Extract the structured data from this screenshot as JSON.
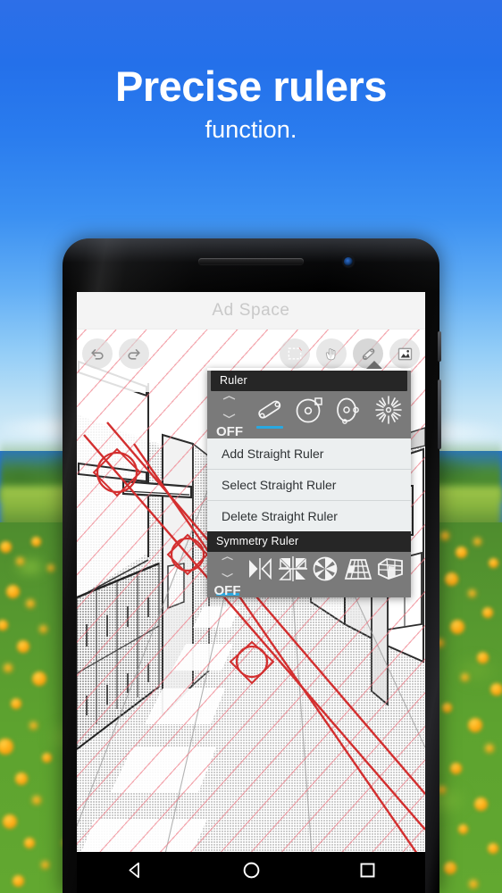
{
  "headline": {
    "line1": "Precise rulers",
    "line2": "function."
  },
  "colors": {
    "sky_top": "#2d6fe8",
    "sky_bottom": "#d8eef8",
    "accent_blue": "#29a8e0",
    "popup_title_bg": "#262626",
    "popup_body_bg": "#7a7a7a",
    "menu_bg": "#eceff0",
    "guide_line": "#ee7480",
    "ruler_line": "#d32f2f"
  },
  "phone": {
    "ad_banner": {
      "label": "Ad Space"
    },
    "toolbar": {
      "left": [
        {
          "name": "undo-button",
          "icon": "undo-icon"
        },
        {
          "name": "redo-button",
          "icon": "redo-icon"
        }
      ],
      "right": [
        {
          "name": "selection-button",
          "icon": "marquee-select-icon"
        },
        {
          "name": "transform-button",
          "icon": "hand-drag-icon"
        },
        {
          "name": "ruler-button",
          "icon": "ruler-pen-icon"
        },
        {
          "name": "layers-button",
          "icon": "image-layer-icon"
        }
      ]
    },
    "ruler_popup": {
      "ruler_section": {
        "title": "Ruler",
        "options": [
          {
            "label": "OFF",
            "icon": "off-icon",
            "active": false
          },
          {
            "label": "",
            "icon": "straight-ruler-icon",
            "active": true
          },
          {
            "label": "",
            "icon": "circle-ruler-icon",
            "active": false
          },
          {
            "label": "",
            "icon": "ellipse-ruler-icon",
            "active": false
          },
          {
            "label": "",
            "icon": "radial-burst-ruler-icon",
            "active": false
          }
        ]
      },
      "menu_items": [
        "Add Straight Ruler",
        "Select Straight Ruler",
        "Delete Straight Ruler"
      ],
      "symmetry_section": {
        "title": "Symmetry Ruler",
        "options": [
          {
            "label": "OFF",
            "icon": "off-icon",
            "active": true
          },
          {
            "label": "",
            "icon": "mirror-symmetry-icon",
            "active": false
          },
          {
            "label": "",
            "icon": "quad-symmetry-icon",
            "active": false
          },
          {
            "label": "",
            "icon": "radial-symmetry-icon",
            "active": false
          },
          {
            "label": "",
            "icon": "perspective-grid-icon",
            "active": false
          },
          {
            "label": "",
            "icon": "box-grid-icon",
            "active": false
          }
        ]
      }
    },
    "navbar": [
      {
        "name": "nav-back-button",
        "icon": "triangle-back-icon"
      },
      {
        "name": "nav-home-button",
        "icon": "circle-home-icon"
      },
      {
        "name": "nav-recents-button",
        "icon": "square-recents-icon"
      }
    ]
  }
}
